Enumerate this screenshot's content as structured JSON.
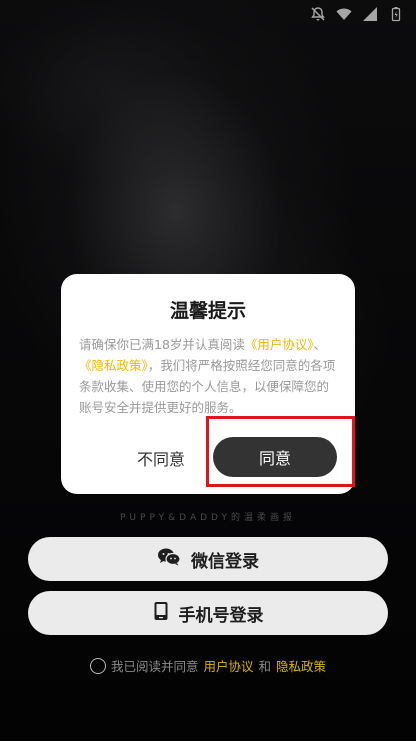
{
  "dialog": {
    "title": "温馨提示",
    "body_prefix": "请确保你已满18岁并认真阅读",
    "link_user": "《用户协议》",
    "sep": "、",
    "link_privacy": "《隐私政策》",
    "body_suffix": "，我们将严格按照经您同意的各项条款收集、使用您的个人信息，以便保障您的账号安全并提供更好的服务。",
    "disagree_label": "不同意",
    "agree_label": "同意"
  },
  "tagline": "PUPPY&DADDY的温柔画报",
  "login": {
    "wechat_label": "微信登录",
    "phone_label": "手机号登录"
  },
  "agreement": {
    "prefix": "我已阅读并同意",
    "link_user": "用户协议",
    "and": "和",
    "link_privacy": "隐私政策"
  },
  "colors": {
    "accent_link": "#f2b705",
    "agree_button": "#333333",
    "highlight_border": "#e0141c"
  },
  "icons": [
    "mute-icon",
    "wifi-icon",
    "signal-icon",
    "battery-icon",
    "wechat-icon",
    "phone-icon"
  ]
}
